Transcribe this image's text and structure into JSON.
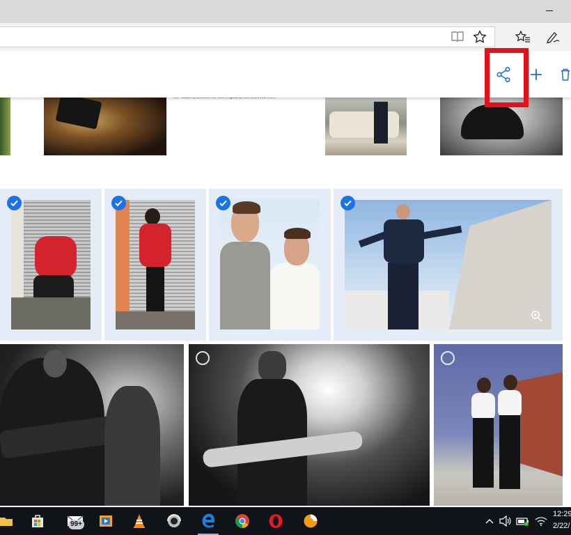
{
  "window": {
    "minimize_glyph": "—"
  },
  "navbar": {
    "icons": [
      "reading-view-icon",
      "favorite-star-icon",
      "favorites-hub-icon",
      "web-note-pen-icon"
    ]
  },
  "toolbar": {
    "actions": [
      "share-icon",
      "add-icon",
      "delete-icon"
    ],
    "highlight_color": "#e1121b",
    "accent_color": "#1b6fd6"
  },
  "top_strip": {
    "caption": "Me: \"suddenly becomes the most religious person you'll ever meet\""
  },
  "rows": {
    "selected_photos": 4,
    "unselected_photos": 3
  },
  "taskbar": {
    "notification_badge": "99+",
    "clock_time": "12:29",
    "clock_date": "2/22/"
  },
  "colors": {
    "selection_check": "#1a73e8",
    "selection_background": "#e4ecf7",
    "taskbar": "#101418"
  }
}
